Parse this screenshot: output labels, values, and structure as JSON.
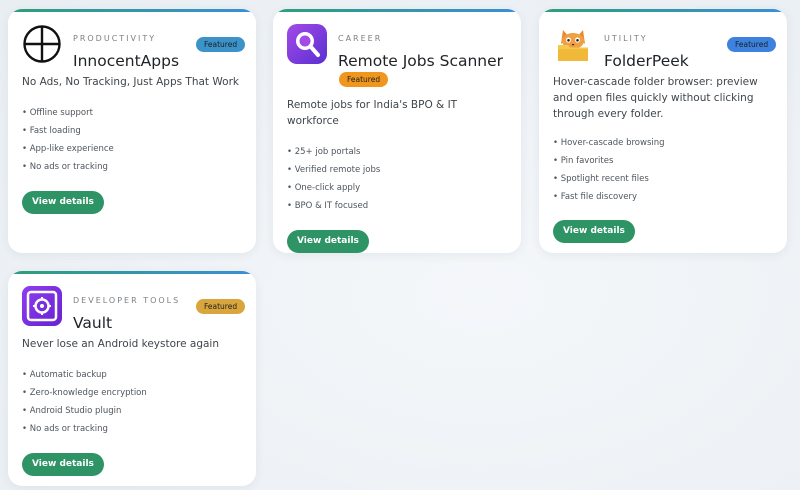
{
  "cards": [
    {
      "category": "PRODUCTIVITY",
      "name": "InnocentApps",
      "badge": "Featured",
      "badge_color": "#3b93c9",
      "icon": "circle-plus-icon",
      "tagline": "No Ads, No Tracking, Just Apps That Work",
      "features": [
        "Offline support",
        "Fast loading",
        "App-like experience",
        "No ads or tracking"
      ],
      "button": "View details"
    },
    {
      "category": "CAREER",
      "name": "Remote Jobs Scanner",
      "badge": "Featured",
      "badge_color": "#f0961c",
      "icon": "magnifier-icon",
      "tagline": "Remote jobs for India's BPO & IT workforce",
      "features": [
        "25+ job portals",
        "Verified remote jobs",
        "One-click apply",
        "BPO & IT focused"
      ],
      "button": "View details"
    },
    {
      "category": "UTILITY",
      "name": "FolderPeek",
      "badge": "Featured",
      "badge_color": "#3c82de",
      "icon": "fox-folder-icon",
      "tagline": "Hover-cascade folder browser: preview and open files quickly without clicking through every folder.",
      "features": [
        "Hover-cascade browsing",
        "Pin favorites",
        "Spotlight recent files",
        "Fast file discovery"
      ],
      "button": "View details"
    },
    {
      "category": "DEVELOPER TOOLS",
      "name": "Vault",
      "badge": "Featured",
      "badge_color": "#d9a53c",
      "icon": "vault-safe-icon",
      "tagline": "Never lose an Android keystore again",
      "features": [
        "Automatic backup",
        "Zero-knowledge encryption",
        "Android Studio plugin",
        "No ads or tracking"
      ],
      "button": "View details"
    }
  ],
  "colors": {
    "button": "#2e9466",
    "accent_bar": "#3a8fd6"
  }
}
